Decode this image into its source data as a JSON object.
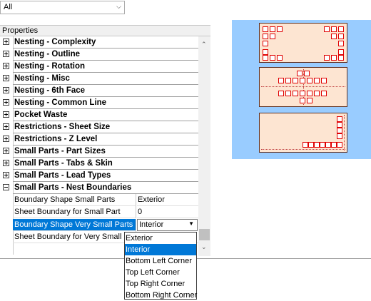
{
  "filter": {
    "value": "All"
  },
  "properties": {
    "header": "Properties",
    "categories": [
      "Nesting - Complexity",
      "Nesting - Outline",
      "Nesting - Rotation",
      "Nesting - Misc",
      "Nesting - 6th Face",
      "Nesting - Common Line",
      "Pocket Waste",
      "Restrictions - Sheet Size",
      "Restrictions - Z Level",
      "Small Parts - Part Sizes",
      "Small Parts - Tabs & Skin",
      "Small Parts - Lead Types",
      "Small Parts - Nest Boundaries"
    ],
    "rows": [
      {
        "name": "Boundary Shape Small Parts",
        "value": "Exterior"
      },
      {
        "name": "Sheet Boundary for Small Part",
        "value": "0"
      },
      {
        "name": "Boundary Shape Very Small Parts",
        "value": "Interior"
      },
      {
        "name": "Sheet Boundary for Very Small P",
        "value": ""
      }
    ]
  },
  "dropdown": {
    "selected": "Interior",
    "options": [
      "Exterior",
      "Interior",
      "Bottom Left Corner",
      "Top Left Corner",
      "Top Right Corner",
      "Bottom Right Corner"
    ]
  },
  "preview": {
    "colors": {
      "background": "#99ccff",
      "sheet": "#fde5d2",
      "part_border": "#e00000"
    },
    "sheets": [
      "exterior-boundary",
      "interior-boundary",
      "bottom-right-corner"
    ]
  }
}
